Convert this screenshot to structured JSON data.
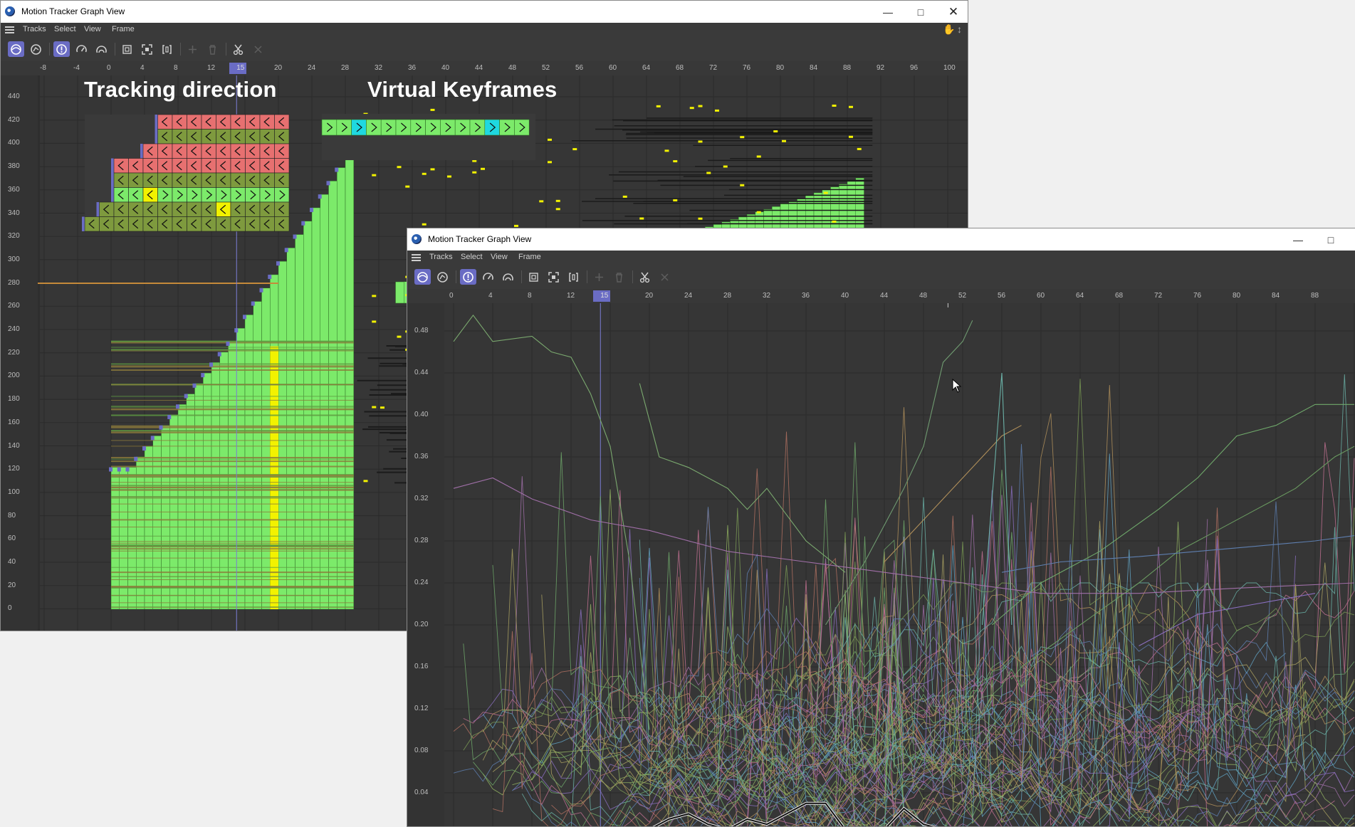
{
  "window1": {
    "title": "Motion Tracker Graph View",
    "menu": [
      "Tracks",
      "Select",
      "View",
      "Frame"
    ],
    "ruler_ticks": [
      "-8",
      "-4",
      "0",
      "4",
      "8",
      "12",
      "15",
      "20",
      "24",
      "28",
      "32",
      "36",
      "40",
      "44",
      "48",
      "52",
      "56",
      "60",
      "64",
      "68",
      "72",
      "76",
      "80",
      "84",
      "88",
      "92",
      "96",
      "100"
    ],
    "y_ticks": [
      "440",
      "420",
      "400",
      "380",
      "360",
      "340",
      "320",
      "300",
      "280",
      "260",
      "240",
      "220",
      "200",
      "180",
      "160",
      "140",
      "120",
      "100",
      "80",
      "60",
      "40",
      "20",
      "0"
    ],
    "current_frame": "15",
    "label_tracking": "Tracking direction",
    "label_virtual": "Virtual Keyframes"
  },
  "window2": {
    "title": "Motion Tracker Graph View",
    "menu": [
      "Tracks",
      "Select",
      "View",
      "Frame"
    ],
    "ruler_ticks": [
      "0",
      "4",
      "8",
      "12",
      "15",
      "20",
      "24",
      "28",
      "32",
      "36",
      "40",
      "44",
      "48",
      "52",
      "56",
      "60",
      "64",
      "68",
      "72",
      "76",
      "80",
      "84",
      "88"
    ],
    "y_ticks": [
      "0.48",
      "0.44",
      "0.40",
      "0.36",
      "0.32",
      "0.28",
      "0.24",
      "0.20",
      "0.16",
      "0.12",
      "0.08",
      "0.04"
    ],
    "current_frame": "15"
  },
  "colors": {
    "track_green": "#7cea6a",
    "track_red": "#e77070",
    "track_olive": "#7e9a3e",
    "keyframe_yellow": "#f2f200",
    "virtual_cyan": "#1fd8e0",
    "frame_marker": "#6a6cc4",
    "active_button": "#6a6cc4"
  }
}
